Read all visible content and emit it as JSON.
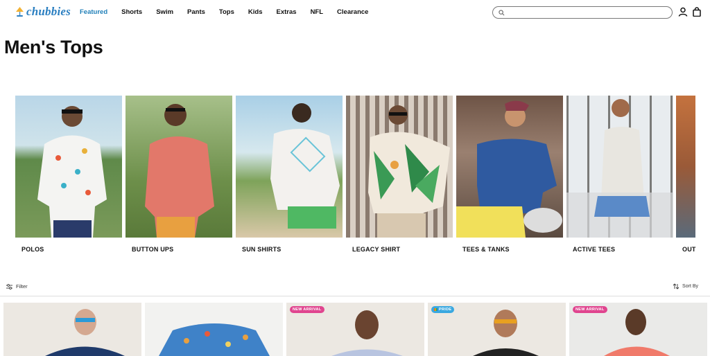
{
  "brand": {
    "name": "chubbies"
  },
  "nav": {
    "items": [
      "Featured",
      "Shorts",
      "Swim",
      "Pants",
      "Tops",
      "Kids",
      "Extras",
      "NFL",
      "Clearance"
    ]
  },
  "search": {
    "placeholder": ""
  },
  "page": {
    "title": "Men's Tops"
  },
  "categories": [
    {
      "label": "POLOS"
    },
    {
      "label": "BUTTON UPS"
    },
    {
      "label": "SUN SHIRTS"
    },
    {
      "label": "LEGACY SHIRT"
    },
    {
      "label": "TEES & TANKS"
    },
    {
      "label": "ACTIVE TEES"
    },
    {
      "label": "OUT"
    }
  ],
  "toolbar": {
    "filter_label": "Filter",
    "sort_label": "Sort By"
  },
  "products": [
    {
      "badge": ""
    },
    {
      "badge": ""
    },
    {
      "badge": "NEW ARRIVAL"
    },
    {
      "badge": "PRIDE"
    },
    {
      "badge": "NEW ARRIVAL"
    }
  ],
  "colors": {
    "accent": "#1f7fb8",
    "logo": "#2b7fc1",
    "badge_new": "#e0458f",
    "badge_pride": "#3aa8e0"
  }
}
